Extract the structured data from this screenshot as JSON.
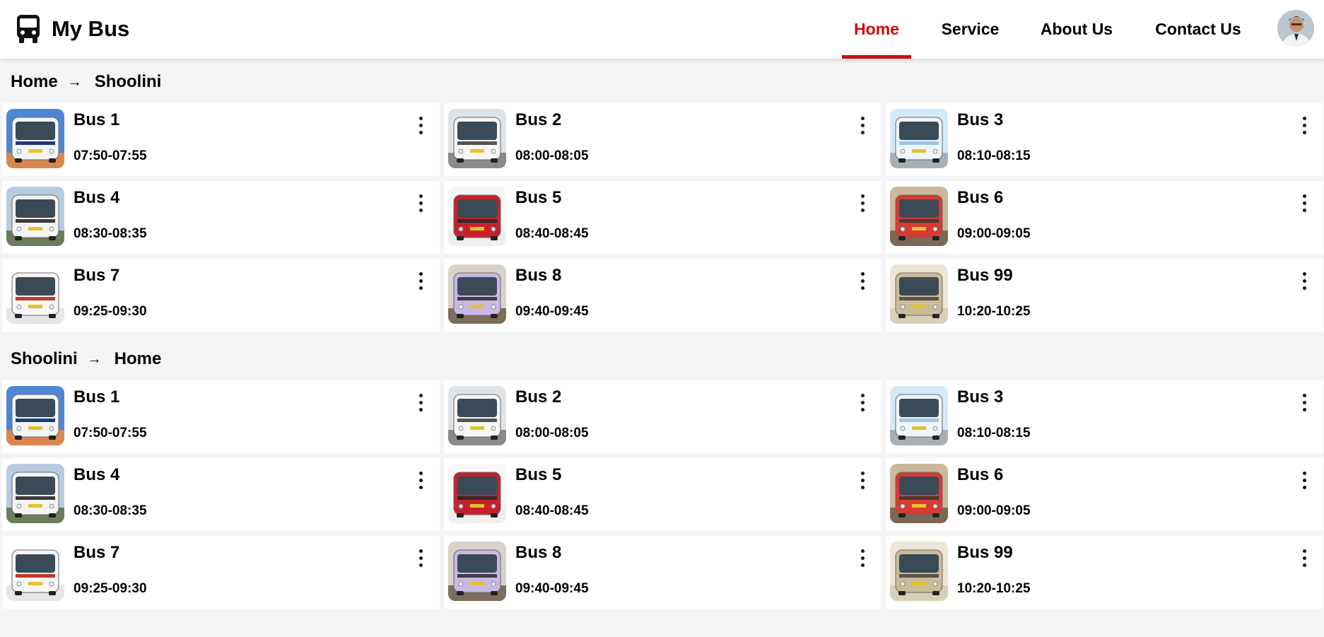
{
  "app": {
    "brand": "My Bus",
    "brand_icon": "bus-icon",
    "accent_color": "#d10a0a"
  },
  "nav": {
    "items": [
      {
        "label": "Home",
        "active": true
      },
      {
        "label": "Service",
        "active": false
      },
      {
        "label": "About Us",
        "active": false
      },
      {
        "label": "Contact Us",
        "active": false
      }
    ],
    "avatar_icon": "user-avatar"
  },
  "sections": [
    {
      "from": "Home",
      "to": "Shoolini",
      "buses": [
        {
          "name": "Bus 1",
          "time": "07:50-07:55",
          "body": "#f2f4f8",
          "trim": "#1d3a7a",
          "ground": "#d9874f",
          "sky": "#4d86d6"
        },
        {
          "name": "Bus 2",
          "time": "08:00-08:05",
          "body": "#f6f6f6",
          "trim": "#555555",
          "ground": "#8a8a8a",
          "sky": "#dfe3e6"
        },
        {
          "name": "Bus 3",
          "time": "08:10-08:15",
          "body": "#eef5fb",
          "trim": "#9cc6e8",
          "ground": "#a8b0b6",
          "sky": "#d3e9f7"
        },
        {
          "name": "Bus 4",
          "time": "08:30-08:35",
          "body": "#f4f4f4",
          "trim": "#3a3a3a",
          "ground": "#6e7d59",
          "sky": "#b6cbe0"
        },
        {
          "name": "Bus 5",
          "time": "08:40-08:45",
          "body": "#c8202a",
          "trim": "#2a2a2a",
          "ground": "#eeeeee",
          "sky": "#f7f7f7"
        },
        {
          "name": "Bus 6",
          "time": "09:00-09:05",
          "body": "#d63a32",
          "trim": "#4a3a2e",
          "ground": "#7a6a55",
          "sky": "#c9b99a"
        },
        {
          "name": "Bus 7",
          "time": "09:25-09:30",
          "body": "#f7f7f7",
          "trim": "#c0392b",
          "ground": "#e6e6e6",
          "sky": "#ffffff"
        },
        {
          "name": "Bus 8",
          "time": "09:40-09:45",
          "body": "#c9b8e6",
          "trim": "#3f3f3f",
          "ground": "#7b6f5a",
          "sky": "#d8d3c8"
        },
        {
          "name": "Bus 99",
          "time": "10:20-10:25",
          "body": "#c9bc97",
          "trim": "#5a5448",
          "ground": "#d8cfb8",
          "sky": "#ece6d6"
        }
      ]
    },
    {
      "from": "Shoolini",
      "to": "Home",
      "buses": [
        {
          "name": "Bus 1",
          "time": "07:50-07:55",
          "body": "#f2f4f8",
          "trim": "#1d3a7a",
          "ground": "#d9874f",
          "sky": "#4d86d6"
        },
        {
          "name": "Bus 2",
          "time": "08:00-08:05",
          "body": "#f6f6f6",
          "trim": "#555555",
          "ground": "#8a8a8a",
          "sky": "#dfe3e6"
        },
        {
          "name": "Bus 3",
          "time": "08:10-08:15",
          "body": "#eef5fb",
          "trim": "#9cc6e8",
          "ground": "#a8b0b6",
          "sky": "#d3e9f7"
        },
        {
          "name": "Bus 4",
          "time": "08:30-08:35",
          "body": "#f4f4f4",
          "trim": "#3a3a3a",
          "ground": "#6e7d59",
          "sky": "#b6cbe0"
        },
        {
          "name": "Bus 5",
          "time": "08:40-08:45",
          "body": "#c8202a",
          "trim": "#2a2a2a",
          "ground": "#eeeeee",
          "sky": "#f7f7f7"
        },
        {
          "name": "Bus 6",
          "time": "09:00-09:05",
          "body": "#d63a32",
          "trim": "#4a3a2e",
          "ground": "#7a6a55",
          "sky": "#c9b99a"
        },
        {
          "name": "Bus 7",
          "time": "09:25-09:30",
          "body": "#f7f7f7",
          "trim": "#c0392b",
          "ground": "#e6e6e6",
          "sky": "#ffffff"
        },
        {
          "name": "Bus 8",
          "time": "09:40-09:45",
          "body": "#c9b8e6",
          "trim": "#3f3f3f",
          "ground": "#7b6f5a",
          "sky": "#d8d3c8"
        },
        {
          "name": "Bus 99",
          "time": "10:20-10:25",
          "body": "#c9bc97",
          "trim": "#5a5448",
          "ground": "#d8cfb8",
          "sky": "#ece6d6"
        }
      ]
    }
  ]
}
